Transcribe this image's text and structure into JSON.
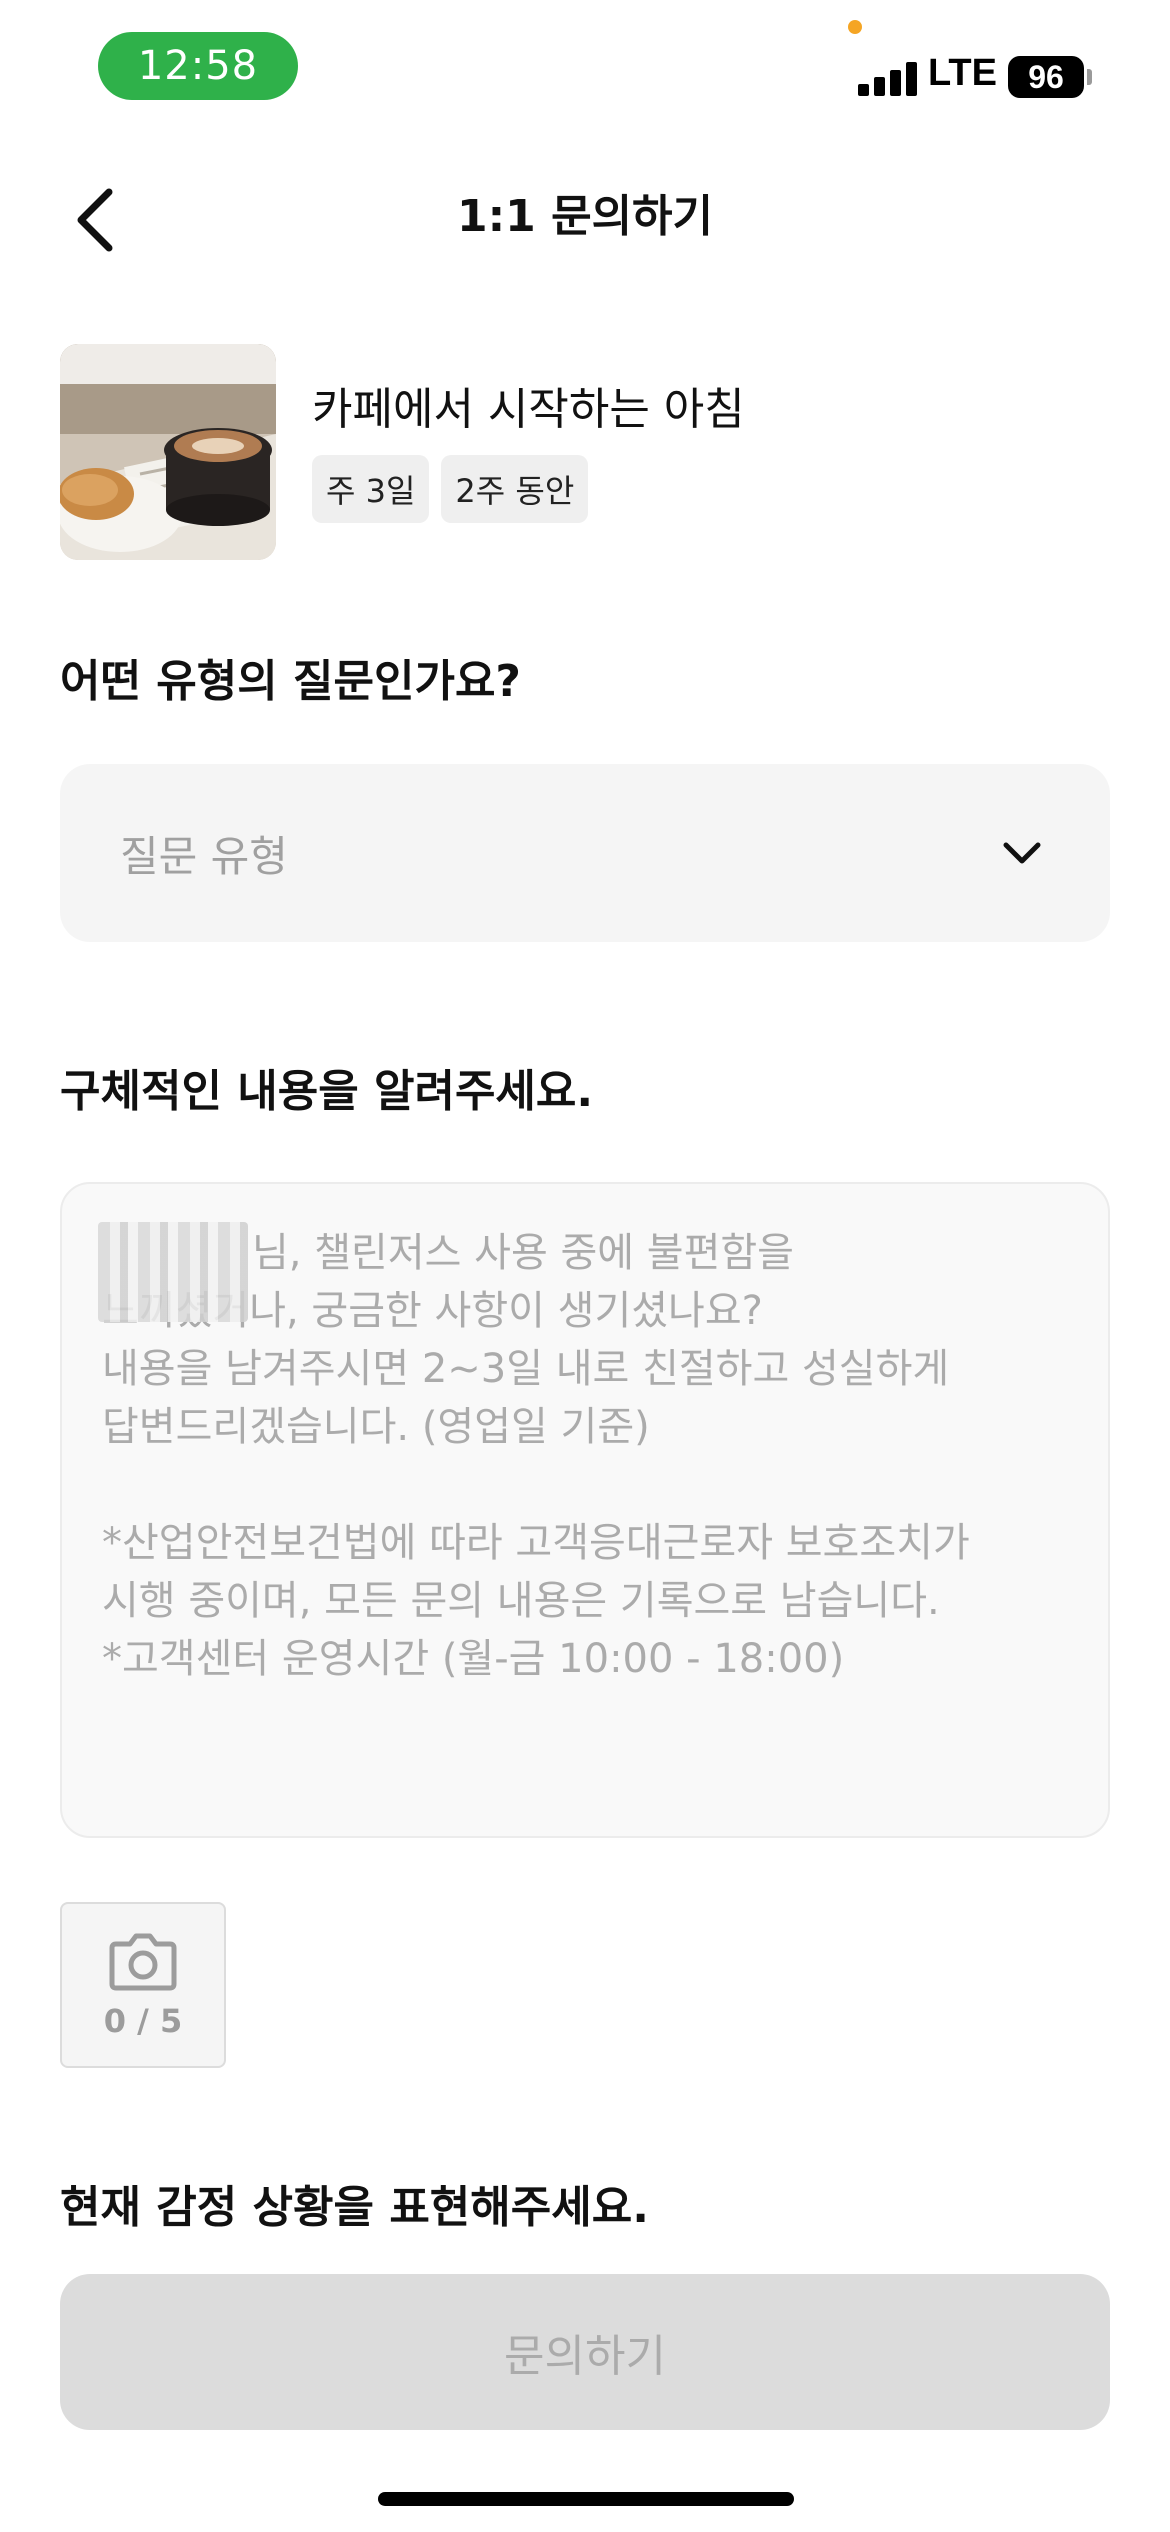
{
  "status_bar": {
    "time": "12:58",
    "network": "LTE",
    "battery": "96"
  },
  "header": {
    "title": "1:1 문의하기",
    "back_icon": "chevron-left-icon"
  },
  "product": {
    "title": "카페에서 시작하는 아침",
    "tags": [
      "주 3일",
      "2주 동안"
    ]
  },
  "question_type": {
    "label": "어떤 유형의 질문인가요?",
    "placeholder": "질문 유형",
    "dropdown_icon": "chevron-down-icon"
  },
  "details": {
    "label": "구체적인 내용을 알려주세요.",
    "placeholder_lines": [
      "님, 챌린저스 사용 중에 불편함을",
      "느끼셨거나, 궁금한 사항이 생기셨나요?",
      "내용을 남겨주시면 2~3일 내로 친절하고 성실하게",
      "답변드리겠습니다. (영업일 기준)",
      "",
      "*산업안전보건법에 따라 고객응대근로자 보호조치가",
      "시행 중이며, 모든 문의 내용은 기록으로 남습니다.",
      "*고객센터 운영시간 (월-금 10:00 - 18:00)"
    ]
  },
  "photo_upload": {
    "icon": "camera-icon",
    "count": "0 / 5"
  },
  "emotion": {
    "label": "현재 감정 상황을 표현해주세요."
  },
  "submit": {
    "label": "문의하기"
  },
  "colors": {
    "status_time_bg": "#2fb14a",
    "field_bg": "#f5f5f5",
    "disabled_button": "#dcdcdc"
  }
}
